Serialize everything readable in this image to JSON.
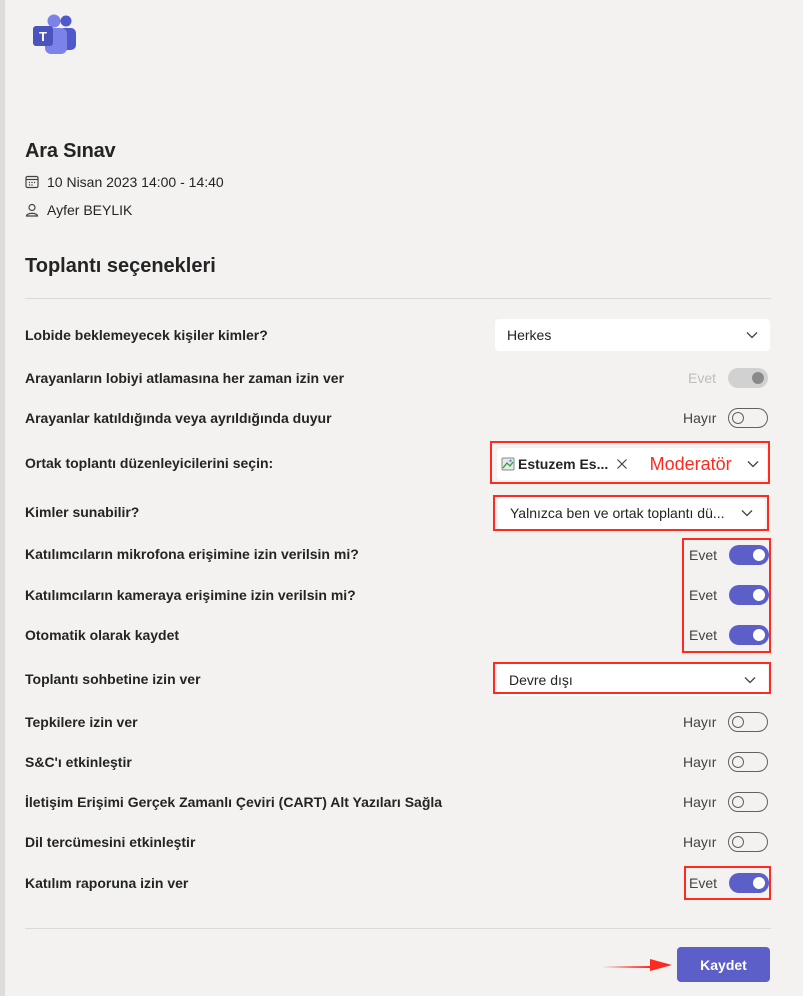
{
  "app": {
    "logo_icon": "teams-logo-icon"
  },
  "meeting": {
    "title": "Ara Sınav",
    "datetime": "10 Nisan 2023 14:00 - 14:40",
    "organizer": "Ayfer BEYLIK"
  },
  "options": {
    "heading": "Toplantı seçenekleri",
    "lobby_bypass_label": "Lobide beklemeyecek kişiler kimler?",
    "lobby_bypass_value": "Herkes",
    "callers_bypass_label": "Arayanların lobiyi atlamasına her zaman izin ver",
    "callers_bypass_state": "Evet",
    "announce_label": "Arayanlar katıldığında veya ayrıldığında duyur",
    "announce_state": "Hayır",
    "coorganizers_label": "Ortak toplantı düzenleyicilerini seçin:",
    "coorganizer_chip": "Estuzem Es...",
    "coorganizer_annotation": "Moderatör",
    "presenters_label": "Kimler sunabilir?",
    "presenters_value": "Yalnızca ben ve ortak toplantı dü...",
    "mic_label": "Katılımcıların mikrofona erişimine izin verilsin mi?",
    "mic_state": "Evet",
    "camera_label": "Katılımcıların kameraya erişimine izin verilsin mi?",
    "camera_state": "Evet",
    "autorecord_label": "Otomatik olarak kaydet",
    "autorecord_state": "Evet",
    "chat_label": "Toplantı sohbetine izin ver",
    "chat_value": "Devre dışı",
    "reactions_label": "Tepkilere izin ver",
    "reactions_state": "Hayır",
    "qa_label": "S&C'ı etkinleştir",
    "qa_state": "Hayır",
    "cart_label": "İletişim Erişimi Gerçek Zamanlı Çeviri (CART) Alt Yazıları Sağla",
    "cart_state": "Hayır",
    "interpretation_label": "Dil tercümesini etkinleştir",
    "interpretation_state": "Hayır",
    "attendance_label": "Katılım raporuna izin ver",
    "attendance_state": "Evet"
  },
  "footer": {
    "save_label": "Kaydet"
  },
  "colors": {
    "accent": "#5b5fc7",
    "annotation": "#ff2a1f",
    "background": "#f3f2f1"
  }
}
